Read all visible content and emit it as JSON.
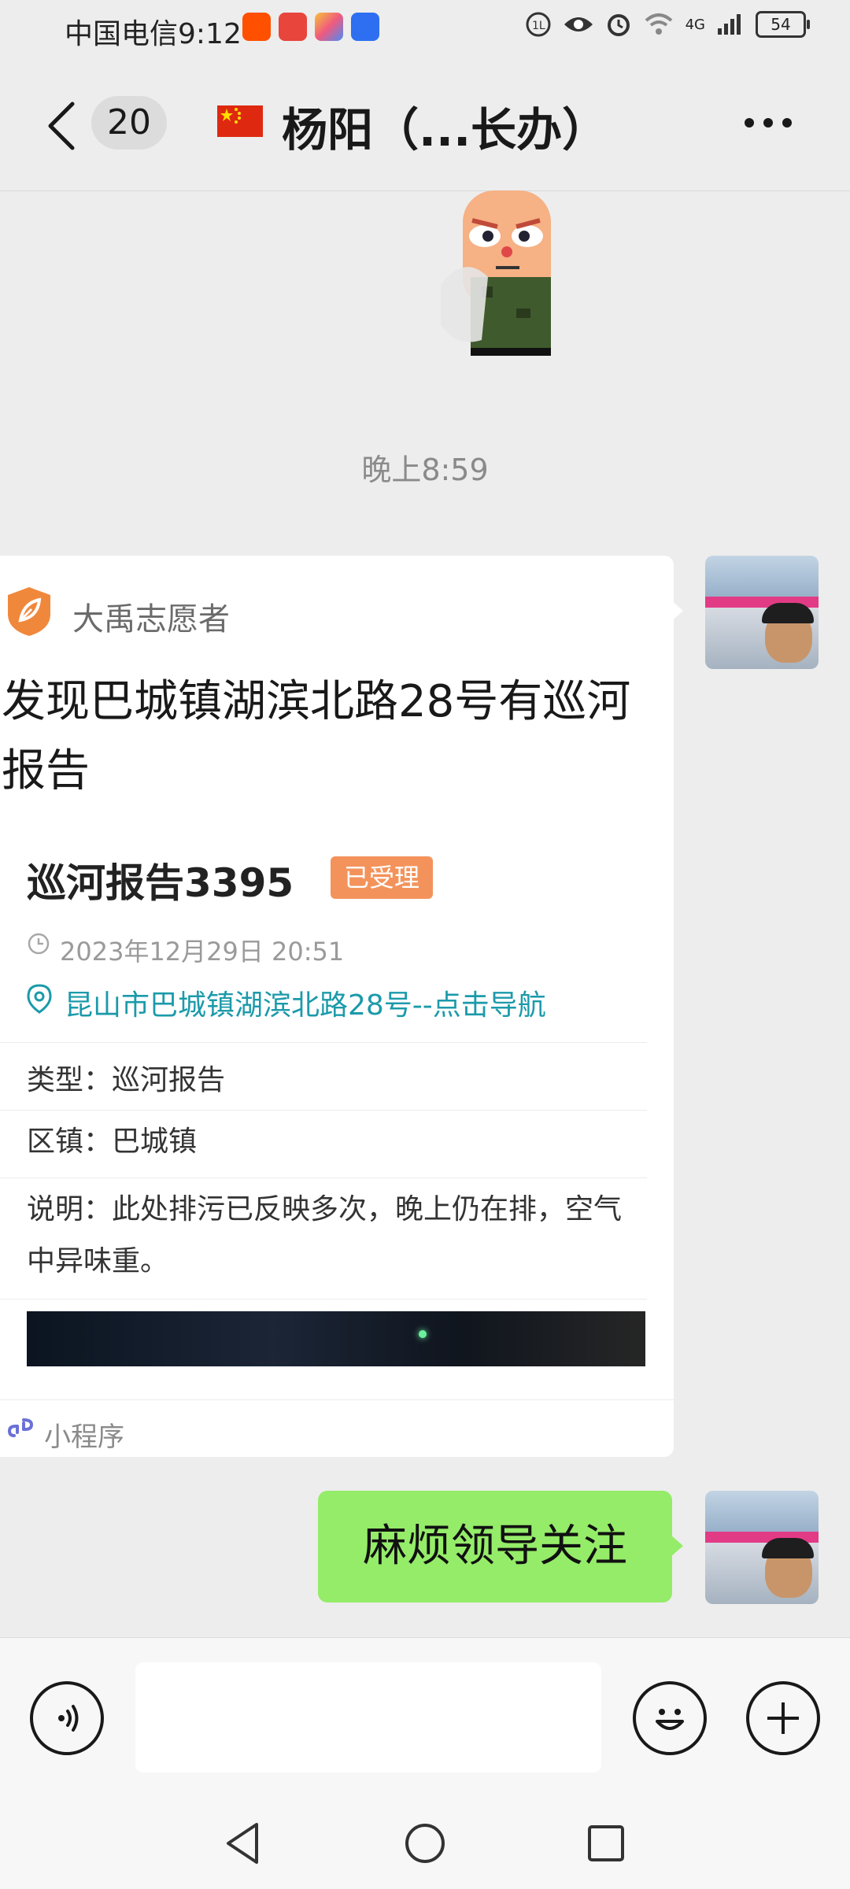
{
  "status_bar": {
    "carrier_time": "中国电信9:12",
    "network": "4G",
    "battery": "54"
  },
  "header": {
    "unread_count": "20",
    "title": "杨阳（...长办）"
  },
  "chat": {
    "timestamp": "晚上8:59",
    "mini_program_card": {
      "app_name": "大禹志愿者",
      "title": "发现巴城镇湖滨北路28号有巡河报告",
      "report_title": "巡河报告3395",
      "status_badge": "已受理",
      "report_time": "2023年12月29日 20:51",
      "location": "昆山市巴城镇湖滨北路28号--点击导航",
      "fields": [
        {
          "label": "类型：",
          "value": "巡河报告"
        },
        {
          "label": "区镇：",
          "value": "巴城镇"
        },
        {
          "label": "说明：",
          "value": "此处排污已反映多次，晚上仍在排，空气中异味重。"
        }
      ],
      "footer_label": "小程序"
    },
    "outgoing_message": "麻烦领导关注"
  },
  "input_bar": {
    "placeholder": ""
  },
  "colors": {
    "outgoing_bubble": "#95ec69",
    "badge": "#f3935b",
    "link": "#1b9aaa",
    "background": "#ededed"
  },
  "icons": [
    "back-arrow-icon",
    "more-icon",
    "voice-icon",
    "emoji-icon",
    "plus-icon",
    "nav-back-icon",
    "nav-home-icon",
    "nav-recent-icon",
    "clock-icon",
    "location-icon",
    "mini-program-icon"
  ]
}
